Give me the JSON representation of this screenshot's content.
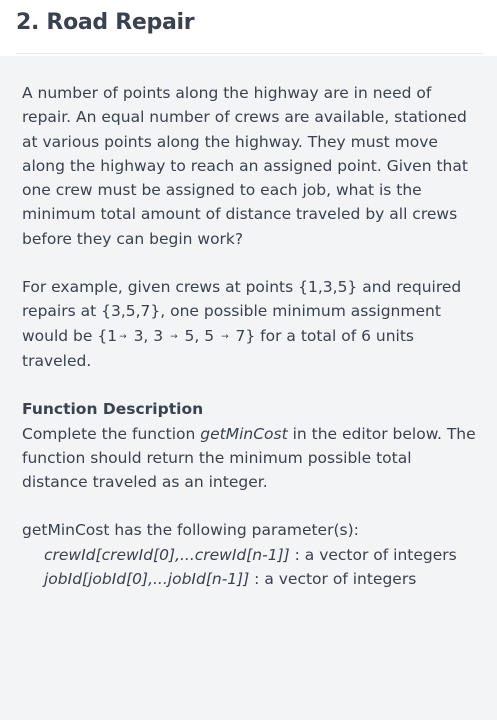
{
  "problem": {
    "title": "2. Road Repair",
    "paragraphs": [
      "A number of points along the highway are in need of repair. An equal number of crews are available, stationed at various points along the highway. They must move along the highway to reach an assigned point. Given that one crew must be assigned to each job, what is the minimum total amount of distance traveled by all crews before they can begin work?"
    ],
    "example": {
      "intro": "For example, given crews at points {1,3,5} and required repairs at {3,5,7}, one possible minimum assignment would be {1",
      "arrow": "→",
      "seg1": " 3, 3 ",
      "seg2": " 5, 5 ",
      "seg3": " 7} for a total of 6 units traveled."
    },
    "function_description": {
      "heading": "Function Description",
      "text_before": "Complete the function ",
      "function_name": "getMinCost",
      "text_after": " in the editor below. The function should return the minimum possible total distance traveled as an integer."
    },
    "parameters": {
      "intro": "getMinCost has the following parameter(s):",
      "items": [
        {
          "name": "crewId[crewId[0],...crewId[n-1]]",
          "desc": " : a vector of integers"
        },
        {
          "name": "jobId[jobId[0],...jobId[n-1]]",
          "desc": " : a vector of integers"
        }
      ]
    }
  }
}
